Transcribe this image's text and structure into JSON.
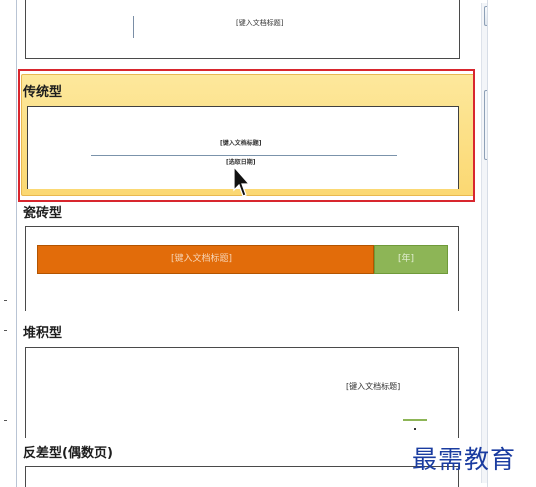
{
  "gallery": {
    "items": [
      {
        "label": "",
        "title_placeholder": "[键入文档标题]"
      },
      {
        "label": "传统型",
        "title_placeholder": "[键入文档标题]",
        "date_placeholder": "[选取日期]",
        "selected": true
      },
      {
        "label": "瓷砖型",
        "title_placeholder": "[键入文档标题]",
        "year_placeholder": "[年]"
      },
      {
        "label": "堆积型",
        "title_placeholder": "[键入文档标题]"
      },
      {
        "label": "反差型(偶数页)"
      }
    ]
  },
  "scrollbar": {
    "up_icon": "arrow-up-icon"
  },
  "colors": {
    "highlight": "#fbd872",
    "selection_outline": "#d8262e",
    "tile_orange": "#e26c0a",
    "tile_green": "#8db556",
    "watermark": "#1a3ca0"
  },
  "watermark": {
    "text": "最需教育"
  }
}
